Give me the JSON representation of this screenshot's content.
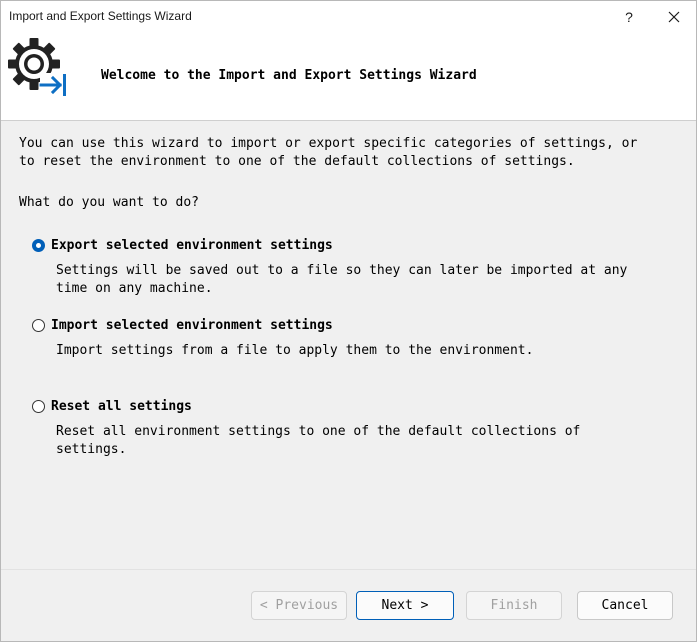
{
  "window": {
    "title": "Import and Export Settings Wizard",
    "help_glyph": "?",
    "close_icon": "close-icon"
  },
  "banner": {
    "icon": "gear-export-icon",
    "title": "Welcome to the Import and Export Settings Wizard",
    "accent": "#0e6fc4"
  },
  "content": {
    "intro_line1": "You can use this wizard to import or export specific categories of settings, or",
    "intro_line2": "to reset the environment to one of the default collections of settings.",
    "question": "What do you want to do?",
    "options": [
      {
        "label": "Export selected environment settings",
        "desc_line1": "Settings will be saved out to a file so they can later be imported at any",
        "desc_line2": "time on any machine.",
        "selected": true
      },
      {
        "label": "Import selected environment settings",
        "desc_line1": "Import settings from a file to apply them to the environment.",
        "selected": false
      },
      {
        "label": "Reset all settings",
        "desc_line1": "Reset all environment settings to one of the default collections of",
        "desc_line2": "settings.",
        "selected": false
      }
    ]
  },
  "buttons": {
    "previous": "< Previous",
    "next": "Next >",
    "finish": "Finish",
    "cancel": "Cancel"
  },
  "colors": {
    "selected_radio": "#005fb8",
    "disabled_text": "#a0a0a0"
  }
}
